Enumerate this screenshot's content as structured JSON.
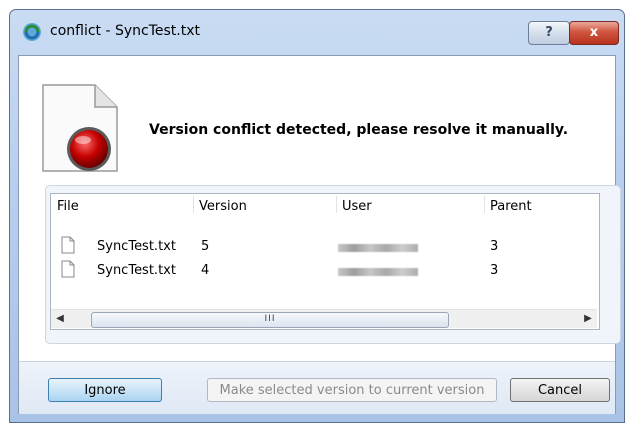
{
  "window": {
    "title": "conflict -  SyncTest.txt",
    "help_label": "?",
    "close_label": "x"
  },
  "message": "Version conflict detected, please resolve it manually.",
  "table": {
    "columns": [
      "File",
      "Version",
      "User",
      "Parent"
    ],
    "rows": [
      {
        "file": "SyncTest.txt",
        "version": "5",
        "user": "",
        "parent": "3"
      },
      {
        "file": "SyncTest.txt",
        "version": "4",
        "user": "",
        "parent": "3"
      }
    ],
    "scroll_thumb_grip": "III",
    "scroll_left_arrow": "◀",
    "scroll_right_arrow": "▶"
  },
  "buttons": {
    "ignore": "Ignore",
    "make_current": "Make selected version to current version",
    "cancel": "Cancel"
  },
  "colors": {
    "accent": "#3c7fb1",
    "conflict_red": "#b00000"
  }
}
